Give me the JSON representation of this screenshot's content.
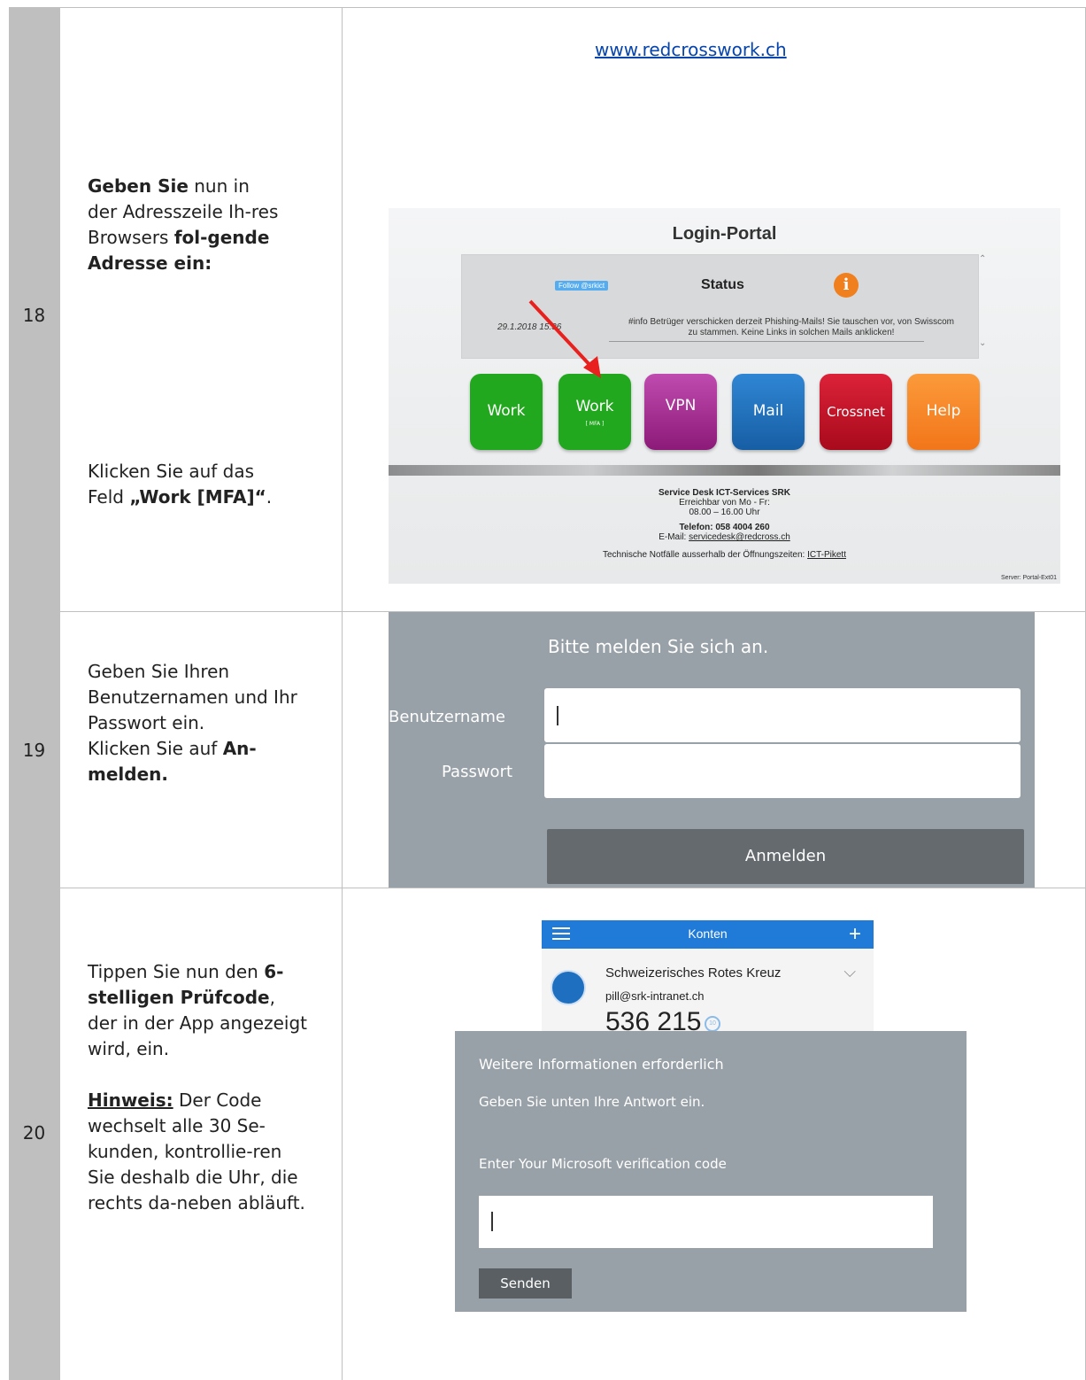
{
  "steps": [
    {
      "number": "18"
    },
    {
      "number": "19"
    },
    {
      "number": "20"
    }
  ],
  "step18": {
    "instr_a": {
      "bold1": "Geben Sie",
      "t1": " nun in der Adresszeile Ih-res Browsers ",
      "bold2": "fol-gende Adresse ein:"
    },
    "instr_b": {
      "t1": "Klicken Sie auf das Feld ",
      "bold1": "„Work [MFA]“",
      "t2": "."
    },
    "url": "www.redcrosswork.ch"
  },
  "portal": {
    "title": "Login-Portal",
    "twitter_label": "Follow @srkict",
    "status_title": "Status",
    "info_icon": "info-icon",
    "status_date": "29.1.2018 15:36",
    "status_msg": "#info Betrüger verschicken derzeit Phishing-Mails! Sie tauschen vor, von Swisscom zu stammen. Keine Links in solchen Mails anklicken!",
    "tiles": [
      {
        "label": "Work",
        "sub": "",
        "color": "#22a81e"
      },
      {
        "label": "Work",
        "sub": "[ MFA ]",
        "color": "#22a81e"
      },
      {
        "label": "VPN",
        "sub": "",
        "color": "#a4288f"
      },
      {
        "label": "Mail",
        "sub": "",
        "color": "#1d6cb8"
      },
      {
        "label": "Crossnet",
        "sub": "",
        "color": "#c20f24"
      },
      {
        "label": "Help",
        "sub": "",
        "color": "#f7841f"
      }
    ],
    "footer": {
      "l1": "Service Desk ICT-Services SRK",
      "l2": "Erreichbar von Mo - Fr:",
      "l3": "08.00 – 16.00 Uhr",
      "l4": "Telefon: 058 4004 260",
      "l5a": "E-Mail: ",
      "l5b": "servicedesk@redcross.ch",
      "l6a": "Technische Notfälle ausserhalb der Öffnungszeiten: ",
      "l6b": "ICT-Pikett"
    },
    "server": "Server: Portal-Ext01"
  },
  "step19": {
    "instr": {
      "t1": "Geben Sie Ihren Benutzernamen und Ihr Passwort ein.",
      "t2": "Klicken Sie auf ",
      "bold1": "An-melden."
    },
    "login_title": "Bitte melden Sie sich an.",
    "username_label": "Benutzername",
    "password_label": "Passwort",
    "button": "Anmelden"
  },
  "step20": {
    "instr": {
      "t1": "Tippen Sie nun den ",
      "bold1": "6-stelligen Prüfcode",
      "t2": ", der in der App angezeigt wird, ein.",
      "hint_label": "Hinweis:",
      "hint_text": " Der Code wechselt alle 30 Se-kunden, kontrollie-ren Sie deshalb die Uhr, die rechts da-neben abläuft."
    },
    "auth": {
      "header": "Konten",
      "account": "Schweizerisches Rotes Kreuz",
      "email": "pill@srk-intranet.ch",
      "code": "536 215",
      "timer": "10"
    },
    "verify": {
      "title": "Weitere Informationen erforderlich",
      "subtitle": "Geben Sie unten Ihre Antwort ein.",
      "prompt": "Enter Your Microsoft verification code",
      "button": "Senden"
    }
  }
}
